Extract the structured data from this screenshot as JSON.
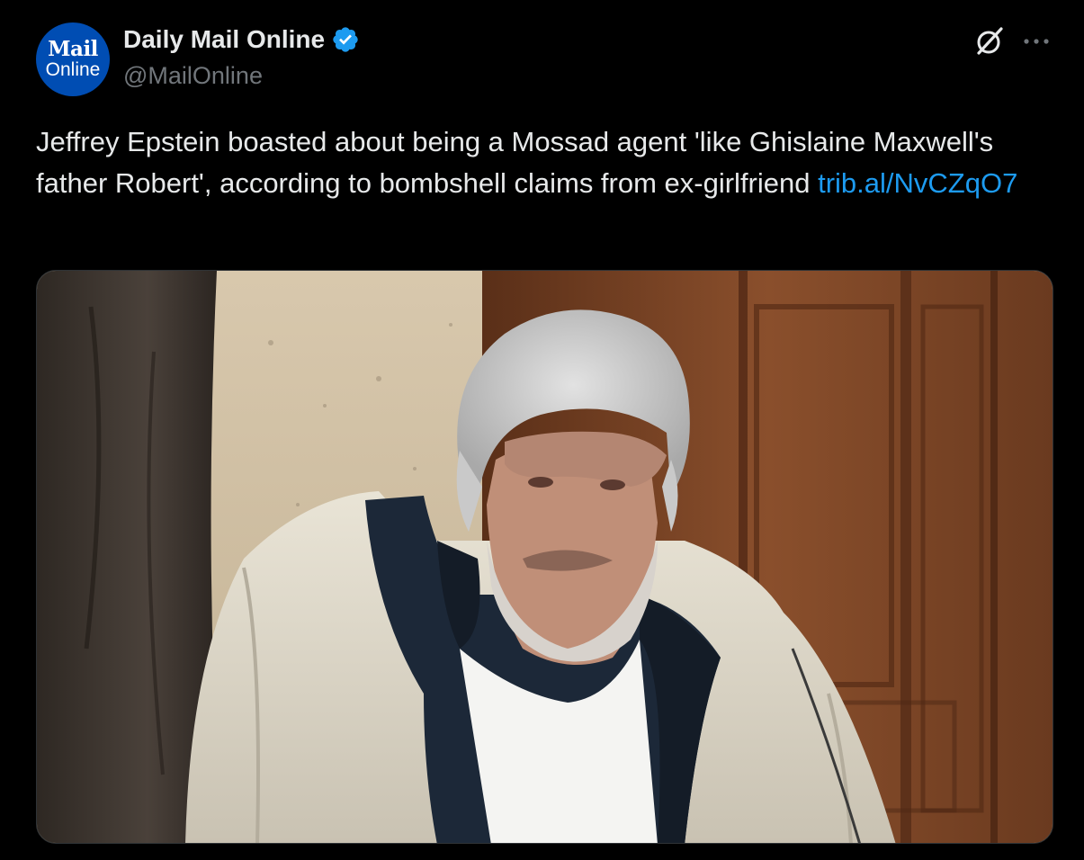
{
  "account": {
    "avatar_logo_top": "Mail",
    "avatar_logo_bottom": "Online",
    "display_name": "Daily Mail Online",
    "handle": "@MailOnline",
    "verified": true
  },
  "icons": {
    "verified": "verified-badge-icon",
    "grok": "grok-icon",
    "more": "more-options-icon"
  },
  "tweet": {
    "text": "Jeffrey Epstein boasted about being a Mossad agent 'like Ghislaine Maxwell's father Robert', according to bombshell claims from ex-girlfriend ",
    "link_text": "trib.al/NvCZqO7"
  },
  "colors": {
    "background": "#000000",
    "primary_text": "#e7e9ea",
    "secondary_text": "#71767b",
    "link": "#1d9bf0",
    "verified_badge": "#1d9bf0",
    "avatar_bg": "#004db3"
  }
}
